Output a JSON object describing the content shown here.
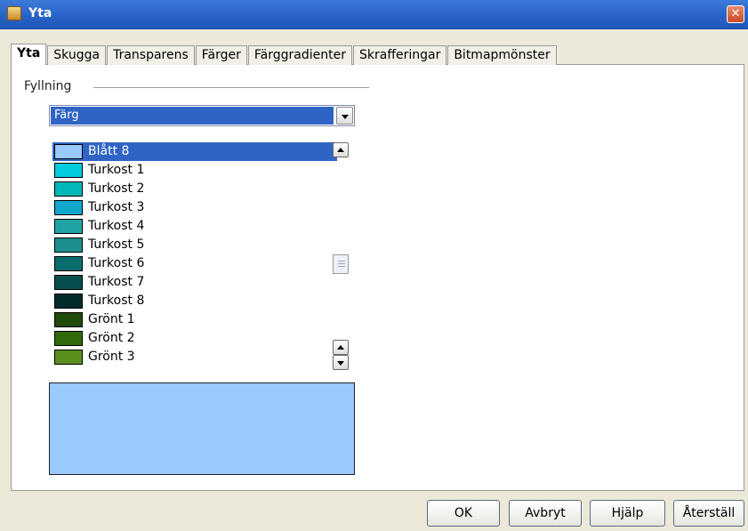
{
  "window": {
    "title": "Yta",
    "close_symbol": "✕",
    "icon": "folder-icon"
  },
  "tabs": [
    {
      "label": "Yta",
      "active": true
    },
    {
      "label": "Skugga",
      "active": false
    },
    {
      "label": "Transparens",
      "active": false
    },
    {
      "label": "Färger",
      "active": false
    },
    {
      "label": "Färggradienter",
      "active": false
    },
    {
      "label": "Skrafferingar",
      "active": false
    },
    {
      "label": "Bitmapmönster",
      "active": false
    }
  ],
  "fill": {
    "section_label": "Fyllning",
    "type_value": "Färg",
    "selected_color": "Blått 8",
    "preview_color": "#99c9fd"
  },
  "colors": [
    {
      "name": "Blått 8",
      "hex": "#99c9fd",
      "selected": true
    },
    {
      "name": "Turkost 1",
      "hex": "#00ccdd"
    },
    {
      "name": "Turkost 2",
      "hex": "#00b7b7"
    },
    {
      "name": "Turkost 3",
      "hex": "#11a7cc"
    },
    {
      "name": "Turkost 4",
      "hex": "#22a3a3"
    },
    {
      "name": "Turkost 5",
      "hex": "#1c8f8f"
    },
    {
      "name": "Turkost 6",
      "hex": "#0a6e6e"
    },
    {
      "name": "Turkost 7",
      "hex": "#064e4e"
    },
    {
      "name": "Turkost 8",
      "hex": "#002b2b"
    },
    {
      "name": "Grönt 1",
      "hex": "#1f4a07"
    },
    {
      "name": "Grönt 2",
      "hex": "#2f6a0b"
    },
    {
      "name": "Grönt 3",
      "hex": "#5a901e"
    }
  ],
  "buttons": {
    "ok": "OK",
    "cancel": "Avbryt",
    "help": "Hjälp",
    "reset": "Återställ"
  }
}
